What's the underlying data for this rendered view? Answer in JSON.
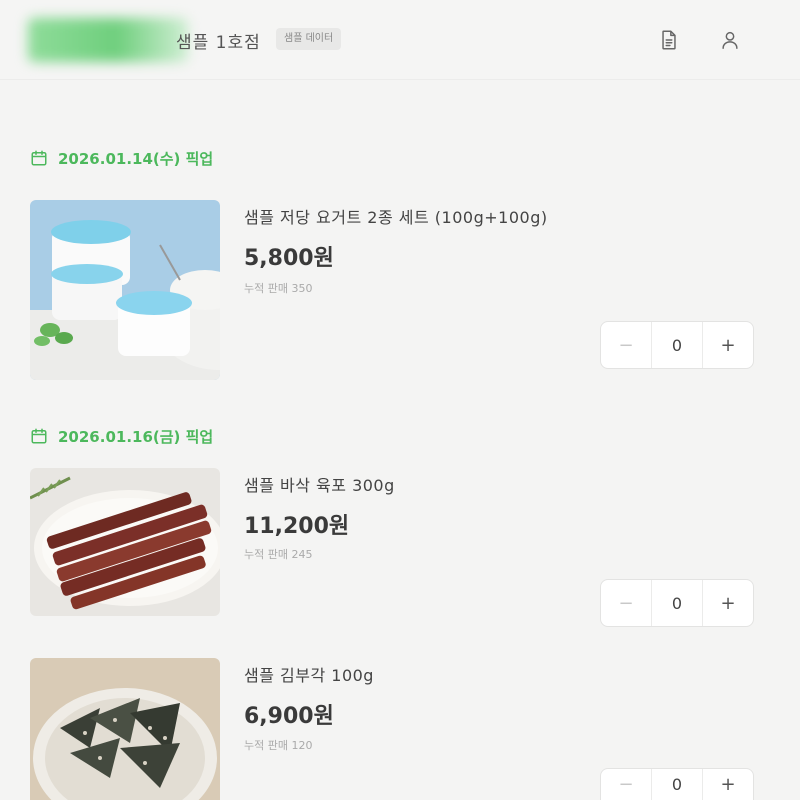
{
  "header": {
    "store_suffix": "샘플 1호점",
    "badge": "샘플 데이터",
    "icons": [
      "document-icon",
      "user-icon"
    ]
  },
  "sections": [
    {
      "date_label": "2026.01.14(수) 픽업",
      "products": [
        {
          "name": "샘플 저당 요거트 2종 세트 (100g+100g)",
          "price": "5,800원",
          "sales": "누적 판매 350",
          "qty": "0",
          "image": "yogurt-image"
        }
      ]
    },
    {
      "date_label": "2026.01.16(금) 픽업",
      "products": [
        {
          "name": "샘플 바삭 육포 300g",
          "price": "11,200원",
          "sales": "누적 판매 245",
          "qty": "0",
          "image": "jerky-image"
        },
        {
          "name": "샘플 김부각 100g",
          "price": "6,900원",
          "sales": "누적 판매 120",
          "qty": "0",
          "image": "seaweed-image"
        }
      ]
    }
  ],
  "colors": {
    "accent": "#4cb85c",
    "background": "#f4f4f3"
  }
}
